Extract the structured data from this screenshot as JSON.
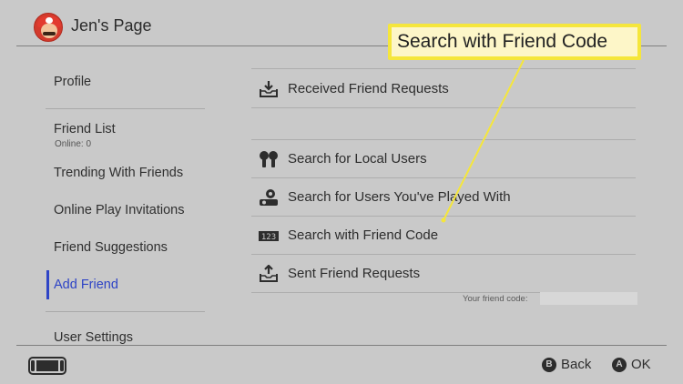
{
  "header": {
    "title": "Jen's Page"
  },
  "sidebar": {
    "items": [
      {
        "label": "Profile"
      },
      {
        "label": "Friend List",
        "sub": "Online: 0"
      },
      {
        "label": "Trending With Friends"
      },
      {
        "label": "Online Play Invitations"
      },
      {
        "label": "Friend Suggestions"
      },
      {
        "label": "Add Friend"
      },
      {
        "label": "User Settings"
      }
    ],
    "active_item": "Add Friend"
  },
  "main": {
    "options": [
      {
        "label": "Received Friend Requests",
        "icon": "inbox-download-icon"
      },
      {
        "label": "Search for Local Users",
        "icon": "local-users-icon"
      },
      {
        "label": "Search for Users You've Played With",
        "icon": "played-with-users-icon"
      },
      {
        "label": "Search with Friend Code",
        "icon": "123-code-icon"
      },
      {
        "label": "Sent Friend Requests",
        "icon": "outbox-upload-icon"
      }
    ],
    "friend_code_label": "Your friend code:"
  },
  "callout": {
    "text": "Search with Friend Code"
  },
  "footer": {
    "back": {
      "key": "B",
      "label": "Back"
    },
    "ok": {
      "key": "A",
      "label": "OK"
    },
    "device_icon": "switch-console-icon"
  },
  "colors": {
    "background": "#c9c9c9",
    "accent": "#2e44c6",
    "callout_border": "#f5e63c"
  }
}
